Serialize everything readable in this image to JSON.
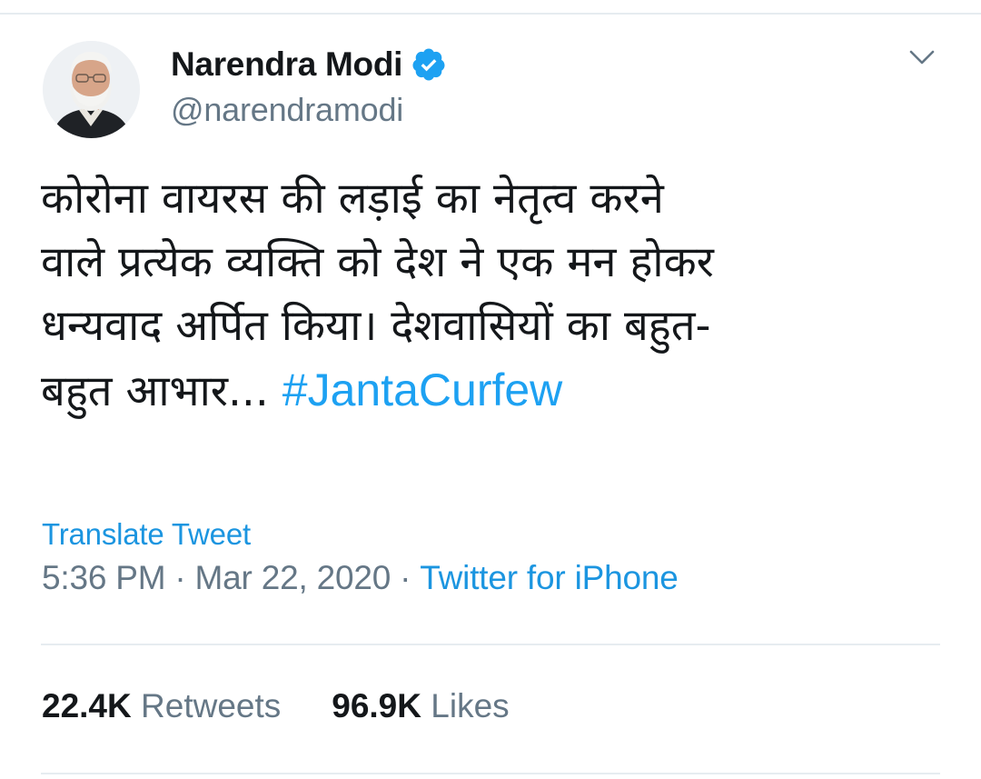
{
  "tweet": {
    "author": {
      "display_name": "Narendra Modi",
      "handle": "@narendramodi",
      "verified": true
    },
    "text_lines": [
      "कोरोना वायरस की लड़ाई का नेतृत्व करने",
      "वाले प्रत्येक व्यक्ति को देश ने एक मन होकर",
      "धन्यवाद अर्पित किया। देशवासियों का बहुत-",
      "बहुत आभार..."
    ],
    "hashtag": "#JantaCurfew",
    "translate_label": "Translate Tweet",
    "time": "5:36 PM",
    "date": "Mar 22, 2020",
    "separator": "·",
    "source": "Twitter for iPhone",
    "stats": {
      "retweets_count": "22.4K",
      "retweets_label": "Retweets",
      "likes_count": "96.9K",
      "likes_label": "Likes"
    }
  },
  "icons": {
    "verified": "verified-badge-icon",
    "menu": "chevron-down-icon"
  },
  "colors": {
    "link": "#1b95e0",
    "hashtag": "#1da1f2",
    "verified": "#1da1f2",
    "secondary_text": "#657786",
    "primary_text": "#14171a",
    "divider": "#e6ecf0"
  }
}
